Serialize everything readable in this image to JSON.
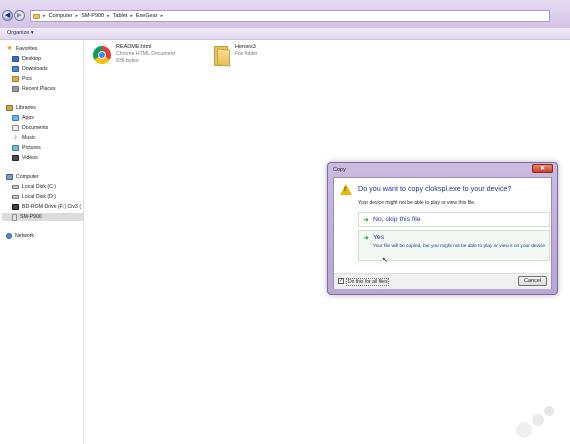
{
  "address_bar": {
    "crumbs": [
      "Computer",
      "SM-P900",
      "Tablet",
      "ExeGear"
    ]
  },
  "toolbar": {
    "organize_label": "Organize ▾"
  },
  "nav": {
    "favorites": {
      "header": "Favorites",
      "items": [
        "Desktop",
        "Downloads",
        "Pics",
        "Recent Places"
      ]
    },
    "libraries": {
      "header": "Libraries",
      "items": [
        "Apps",
        "Documents",
        "Music",
        "Pictures",
        "Videos"
      ]
    },
    "computer": {
      "header": "Computer",
      "items": [
        "Local Disk (C:)",
        "Local Disk (D:)",
        "BD-ROM Drive (F:) Civ3 (",
        "SM-P900"
      ]
    },
    "network": {
      "header": "Network"
    }
  },
  "files": [
    {
      "name": "README.html",
      "type": "Chrome HTML Document",
      "size": "836 bytes",
      "icon": "chrome-icon"
    },
    {
      "name": "Heroes3",
      "type": "File folder",
      "icon": "folder-icon"
    }
  ],
  "dialog": {
    "title": "Copy",
    "close_label": "✕",
    "question": "Do you want to copy clokspl.exe to your device?",
    "subtitle": "Your device might not be able to play or view this file.",
    "option_skip": {
      "label": "No, skip this file"
    },
    "option_yes": {
      "label": "Yes",
      "description": "Your file will be copied, but you might not be able to play or view it on your device."
    },
    "checkbox_label": "Do this for all files",
    "checkbox_checked": true,
    "cancel_label": "Cancel"
  },
  "colors": {
    "accent": "#1f3a93",
    "chrome_bar": "#d3c3e6",
    "warning": "#e9b800",
    "go_arrow": "#2f9d3a"
  }
}
